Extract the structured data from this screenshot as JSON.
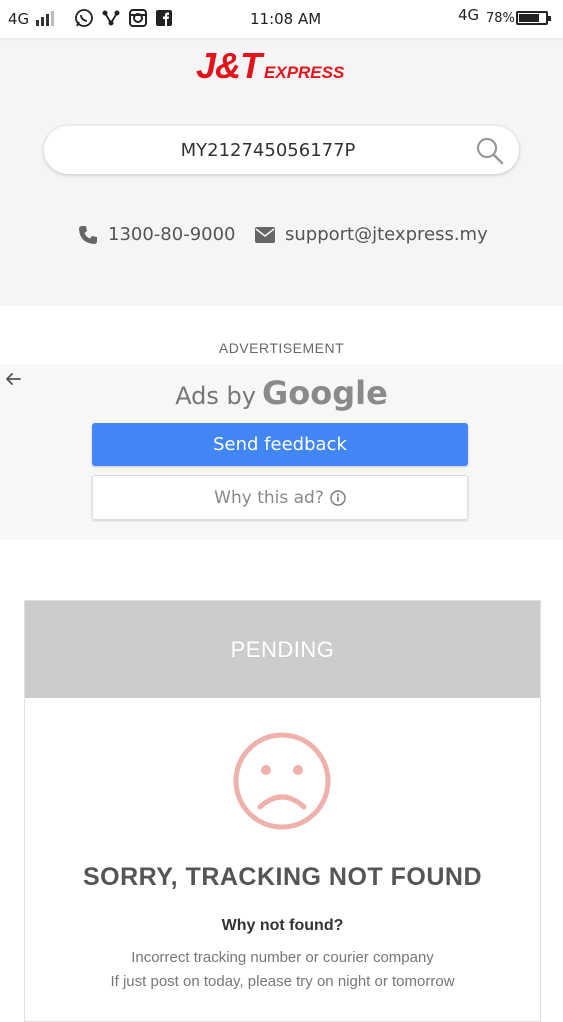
{
  "status_bar": {
    "network_left": "4G",
    "time": "11:08 AM",
    "network_right": "4G",
    "battery_pct": "78%",
    "battery_level": 0.78,
    "icons": [
      "whatsapp-icon",
      "share-icon",
      "instagram-icon",
      "facebook-icon"
    ]
  },
  "brand": {
    "logo_main": "J&T",
    "logo_sub": "EXPRESS",
    "accent": "#e3131b"
  },
  "search": {
    "value": "MY212745056177P",
    "icon": "search-icon"
  },
  "contact": {
    "phone": "1300-80-9000",
    "email": "support@jtexpress.my"
  },
  "ad": {
    "label": "ADVERTISEMENT",
    "ads_by": "Ads by",
    "google": "Google",
    "feedback_button": "Send feedback",
    "why_button": "Why this ad?",
    "button_color": "#4285f4"
  },
  "result": {
    "status": "PENDING",
    "title": "SORRY, TRACKING NOT FOUND",
    "why_heading": "Why not found?",
    "reasons": [
      "Incorrect tracking number or courier company",
      "If just post on today, please try on night or tomorrow"
    ],
    "face_color": "#eeb1ab"
  }
}
